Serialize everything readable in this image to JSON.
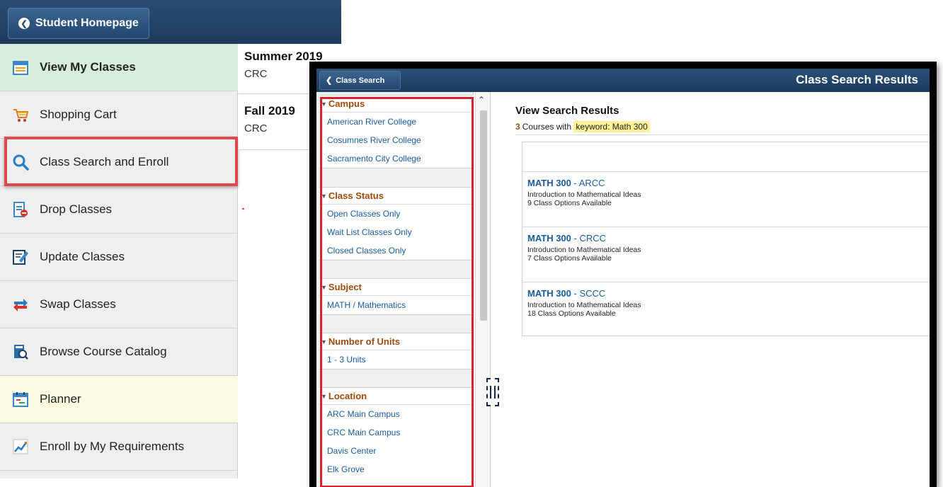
{
  "student": {
    "back_label": "Student Homepage",
    "nav": [
      {
        "label": "View My Classes",
        "icon": "calendar-icon"
      },
      {
        "label": "Shopping Cart",
        "icon": "shopping-cart-icon"
      },
      {
        "label": "Class Search and Enroll",
        "icon": "search-icon"
      },
      {
        "label": "Drop Classes",
        "icon": "drop-classes-icon"
      },
      {
        "label": "Update Classes",
        "icon": "edit-document-icon"
      },
      {
        "label": "Swap Classes",
        "icon": "swap-arrows-icon"
      },
      {
        "label": "Browse Course Catalog",
        "icon": "catalog-search-icon"
      },
      {
        "label": "Planner",
        "icon": "planner-icon"
      },
      {
        "label": "Enroll by My Requirements",
        "icon": "trend-chart-icon"
      }
    ],
    "terms": [
      {
        "name": "Summer 2019",
        "campus": "CRC"
      },
      {
        "name": "Fall 2019",
        "campus": "CRC"
      }
    ]
  },
  "search": {
    "back_label": "Class Search",
    "title": "Class Search Results",
    "facets": [
      {
        "title": "Campus",
        "items": [
          "American River College",
          "Cosumnes River College",
          "Sacramento City College"
        ]
      },
      {
        "title": "Class Status",
        "items": [
          "Open Classes Only",
          "Wait List Classes Only",
          "Closed Classes Only"
        ]
      },
      {
        "title": "Subject",
        "items": [
          "MATH / Mathematics"
        ]
      },
      {
        "title": "Number of Units",
        "items": [
          "1 - 3 Units"
        ]
      },
      {
        "title": "Location",
        "items": [
          "ARC Main Campus",
          "CRC Main Campus",
          "Davis Center",
          "Elk Grove"
        ]
      }
    ],
    "results": {
      "heading": "View Search Results",
      "count": "3",
      "count_text": "Courses with",
      "keyword": "keyword: Math 300",
      "courses": [
        {
          "code": "MATH 300",
          "campus": "ARCC",
          "title": "Introduction to Mathematical Ideas",
          "options": "9 Class Options Available"
        },
        {
          "code": "MATH 300",
          "campus": "CRCC",
          "title": "Introduction to Mathematical Ideas",
          "options": "7 Class Options Available"
        },
        {
          "code": "MATH 300",
          "campus": "SCCC",
          "title": "Introduction to Mathematical Ideas",
          "options": "18 Class Options Available"
        }
      ]
    }
  }
}
